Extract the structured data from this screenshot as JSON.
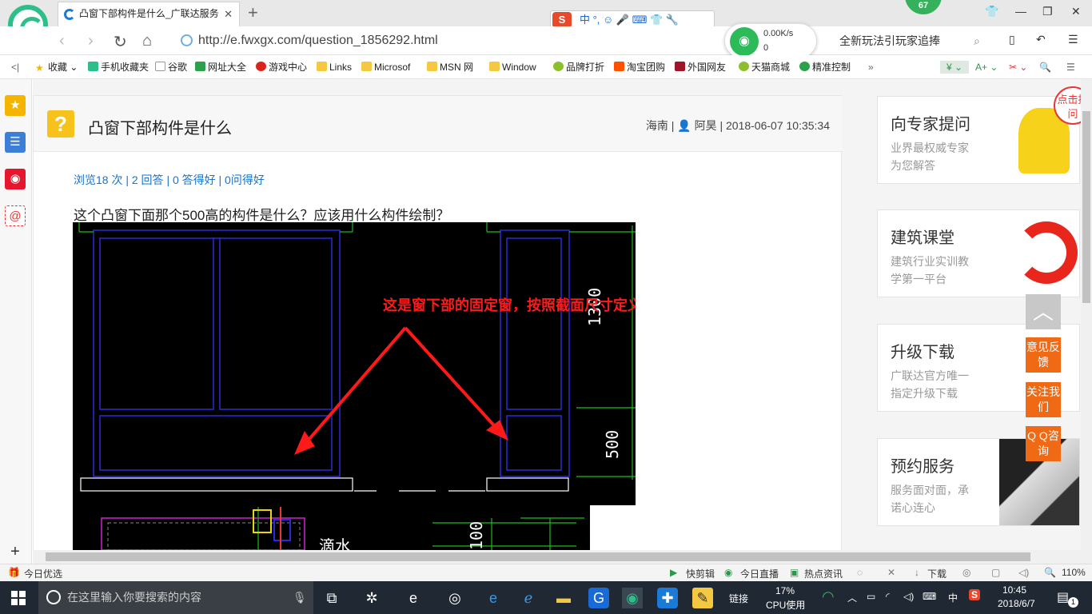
{
  "browser": {
    "tab_title": "凸窗下部构件是什么_广联达服务",
    "new_tab": "+",
    "url": "http://e.fwxgx.com/question_1856292.html",
    "search_text": "全新玩法引玩家追捧",
    "badge_count": "67",
    "ime_label": "中 °, ☺ 🎤 ⌨ 👕 🔧",
    "net_speed": "0.00K/s",
    "net_count": "0"
  },
  "bookmarks": [
    "收藏",
    "手机收藏夹",
    "谷歌",
    "网址大全",
    "游戏中心",
    "Links",
    "Microsof",
    "MSN 网",
    "Window",
    "品牌打折",
    "淘宝团购",
    "外国网友",
    "天猫商城",
    "精准控制"
  ],
  "question": {
    "title": "凸窗下部构件是什么",
    "meta": "海南 | 👤 阿昊 | 2018-06-07 10:35:34",
    "stats": "浏览18 次 | 2 回答 | 0 答得好 | 0问得好",
    "text": "这个凸窗下面那个500高的构件是什么？应该用什么构件绘制？",
    "annotation": "这是窗下部的固定窗，按照截面尺寸定义窗，就可以",
    "dim_1300": "1300",
    "dim_500": "500",
    "dim_100": "100",
    "cad_label": "滴水"
  },
  "ads": [
    {
      "title": "向专家提问",
      "sub1": "业界最权威专家",
      "sub2": "为您解答"
    },
    {
      "title": "建筑课堂",
      "sub1": "建筑行业实训教",
      "sub2": "学第一平台"
    },
    {
      "title": "升级下载",
      "sub1": "广联达官方唯一",
      "sub2": "指定升级下载"
    },
    {
      "title": "预约服务",
      "sub1": "服务面对面，承",
      "sub2": "诺心连心"
    }
  ],
  "float_buttons": {
    "feedback": "意见反馈",
    "follow": "关注我们",
    "qq": "Q Q咨询",
    "top_tag": "点击提问"
  },
  "statusbar": {
    "left": "今日优选",
    "items": [
      "快剪辑",
      "今日直播",
      "热点资讯",
      "下载"
    ],
    "zoom": "110%"
  },
  "taskbar": {
    "search_placeholder": "在这里输入你要搜索的内容",
    "link_label": "链接",
    "cpu_percent": "17%",
    "cpu_label": "CPU使用",
    "ime": "中",
    "time": "10:45",
    "date": "2018/6/7",
    "notif_count": "1"
  },
  "colors": {
    "accent_green": "#2cbf8a",
    "link_blue": "#1a73c9",
    "orange": "#f06a16",
    "annotation_red": "#ff1a1a"
  }
}
